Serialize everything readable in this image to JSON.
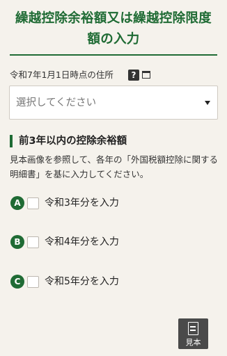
{
  "header": {
    "title_line1": "繰越控除余裕額又は繰越控除限度",
    "title_line2": "額の入力",
    "accent_color": "#1f6b34"
  },
  "address": {
    "label": "令和7年1月1日時点の住所",
    "help_icon_text": "?",
    "help_icon": "help-icon",
    "external_icon": "external-window-icon",
    "select_placeholder": "選択してください",
    "select_icon": "caret-down-icon"
  },
  "section": {
    "title": "前3年以内の控除余裕額",
    "description": "見本画像を参照して、各年の「外国税額控除に関する明細書」を基に入力してください。",
    "options": [
      {
        "badge": "A",
        "label": "令和3年分を入力",
        "checked": false
      },
      {
        "badge": "B",
        "label": "令和4年分を入力",
        "checked": false
      },
      {
        "badge": "C",
        "label": "令和5年分を入力",
        "checked": false
      }
    ]
  },
  "sample_button": {
    "label": "見本",
    "icon": "document-icon"
  }
}
